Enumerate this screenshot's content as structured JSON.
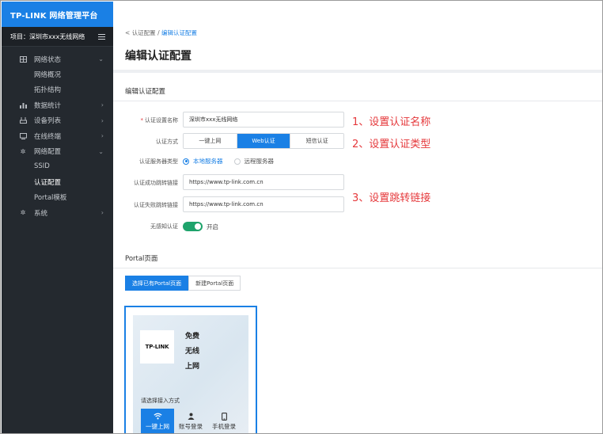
{
  "sidebar": {
    "brand": "TP-LINK 网络管理平台",
    "project": "项目：深圳市xxx无线网络",
    "items": [
      {
        "label": "网络状态",
        "icon": "grid-icon"
      },
      {
        "label": "网络概况"
      },
      {
        "label": "拓扑结构"
      },
      {
        "label": "数据统计",
        "icon": "bar-chart-icon"
      },
      {
        "label": "设备列表",
        "icon": "device-icon"
      },
      {
        "label": "在线终端",
        "icon": "terminal-icon"
      },
      {
        "label": "网络配置",
        "icon": "gear-icon"
      },
      {
        "label": "SSID"
      },
      {
        "label": "认证配置"
      },
      {
        "label": "Portal模板"
      },
      {
        "label": "系统",
        "icon": "gear-icon"
      }
    ]
  },
  "header": {
    "breadcrumb_back": "<",
    "breadcrumb_parent": "认证配置",
    "breadcrumb_sep": "/",
    "breadcrumb_current": "编辑认证配置",
    "title": "编辑认证配置"
  },
  "form": {
    "section_title": "编辑认证配置",
    "name_label": "认证设置名称",
    "name_required": "*",
    "name_value": "深圳市xxx无线网络",
    "method_label": "认证方式",
    "method_options": [
      "一键上网",
      "Web认证",
      "短信认证"
    ],
    "server_label": "认证服务器类型",
    "server_local": "本地服务器",
    "server_remote": "远程服务器",
    "success_label": "认证成功跳转链接",
    "success_value": "https://www.tp-link.com.cn",
    "fail_label": "认证失败跳转链接",
    "fail_value": "https://www.tp-link.com.cn",
    "seamless_label": "无感知认证",
    "seamless_state": "开启"
  },
  "annotations": {
    "a1": "1、设置认证名称",
    "a2": "2、设置认证类型",
    "a3": "3、设置跳转链接"
  },
  "portal": {
    "section_title": "Portal页面",
    "tab_existing": "选择已有Portal页面",
    "tab_new": "新建Portal页面",
    "logo_text": "TP-LINK",
    "free_lines": [
      "免费",
      "无线",
      "上网"
    ],
    "choose_text": "请选择接入方式",
    "login_options": [
      "一键上网",
      "账号登录",
      "手机登录"
    ]
  },
  "colors": {
    "accent": "#1a80e5",
    "sidebar_bg": "#24292f",
    "annotation": "#e5383b",
    "toggle_on": "#1ea36b"
  }
}
